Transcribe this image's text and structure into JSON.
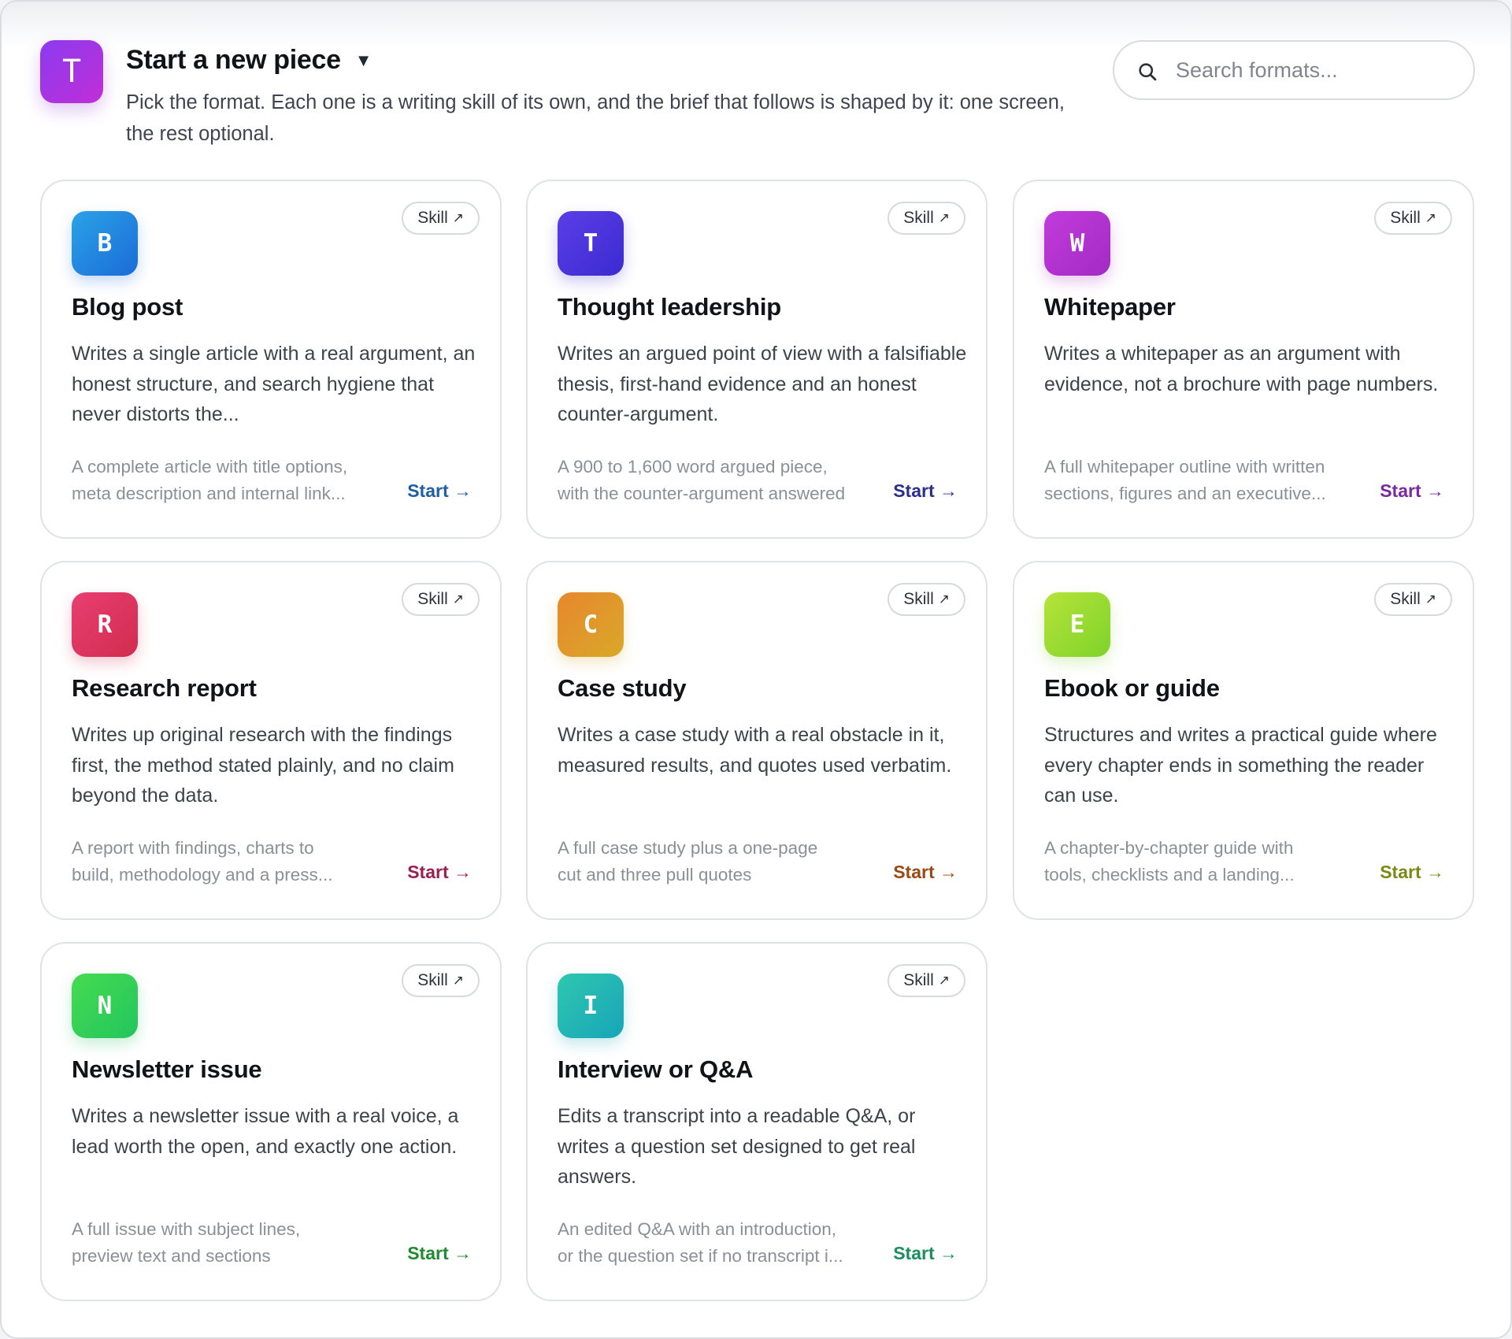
{
  "header": {
    "logo_letter": "T",
    "title": "Start a new piece",
    "caret": "▼",
    "subtitle": "Pick the format. Each one is a writing skill of its own, and the brief that follows is shaped by it: one screen, the rest optional."
  },
  "search": {
    "placeholder": "Search formats..."
  },
  "cards": [
    {
      "letter": "B",
      "title": "Blog post",
      "badge": "Skill",
      "badge_icon": "↗",
      "description": "Writes a single article with a real argument, an honest structure, and search hygiene that never distorts the...",
      "output_line1": "A complete article with title options,",
      "output_line2": "meta description and internal link...",
      "start_label": "Start →",
      "start_color": "#1f5fa3",
      "icon_gradient": [
        "#2aa3e6",
        "#1b6bd8"
      ]
    },
    {
      "letter": "T",
      "title": "Thought leadership",
      "badge": "Skill",
      "badge_icon": "↗",
      "description": "Writes an argued point of view with a falsifiable thesis, first-hand evidence and an honest counter-argument.",
      "output_line1": "A 900 to 1,600 word argued piece,",
      "output_line2": "with the counter-argument answered",
      "start_label": "Start →",
      "start_color": "#2b2f8f",
      "icon_gradient": [
        "#5b3ee6",
        "#3b2bd0"
      ]
    },
    {
      "letter": "W",
      "title": "Whitepaper",
      "badge": "Skill",
      "badge_icon": "↗",
      "description": "Writes a whitepaper as an argument with evidence, not a brochure with page numbers.",
      "output_line1": "A full whitepaper outline with written",
      "output_line2": "sections, figures and an executive...",
      "start_label": "Start →",
      "start_color": "#7a2a9c",
      "icon_gradient": [
        "#c23bdc",
        "#a22bc4"
      ]
    },
    {
      "letter": "R",
      "title": "Research report",
      "badge": "Skill",
      "badge_icon": "↗",
      "description": "Writes up original research with the findings first, the method stated plainly, and no claim beyond the data.",
      "output_line1": "A report with findings, charts to",
      "output_line2": "build, methodology and a press...",
      "start_label": "Start →",
      "start_color": "#9c1f52",
      "icon_gradient": [
        "#e93e72",
        "#d12d4e"
      ]
    },
    {
      "letter": "C",
      "title": "Case study",
      "badge": "Skill",
      "badge_icon": "↗",
      "description": "Writes a case study with a real obstacle in it, measured results, and quotes used verbatim.",
      "output_line1": "A full case study plus a one-page",
      "output_line2": "cut and three pull quotes",
      "start_label": "Start →",
      "start_color": "#9a4a12",
      "icon_gradient": [
        "#e7872e",
        "#d9a828"
      ]
    },
    {
      "letter": "E",
      "title": "Ebook or guide",
      "badge": "Skill",
      "badge_icon": "↗",
      "description": "Structures and writes a practical guide where every chapter ends in something the reader can use.",
      "output_line1": "A chapter-by-chapter guide with",
      "output_line2": "tools, checklists and a landing...",
      "start_label": "Start →",
      "start_color": "#7a8a14",
      "icon_gradient": [
        "#b6e33a",
        "#7ed32a"
      ]
    },
    {
      "letter": "N",
      "title": "Newsletter issue",
      "badge": "Skill",
      "badge_icon": "↗",
      "description": "Writes a newsletter issue with a real voice, a lead worth the open, and exactly one action.",
      "output_line1": "A full issue with subject lines,",
      "output_line2": "preview text and sections",
      "start_label": "Start →",
      "start_color": "#1f8a2f",
      "icon_gradient": [
        "#46db50",
        "#22c55e"
      ]
    },
    {
      "letter": "I",
      "title": "Interview or Q&A",
      "badge": "Skill",
      "badge_icon": "↗",
      "description": "Edits a transcript into a readable Q&A, or writes a question set designed to get real answers.",
      "output_line1": "An edited Q&A with an introduction,",
      "output_line2": "or the question set if no transcript i...",
      "start_label": "Start →",
      "start_color": "#1a8f5c",
      "icon_gradient": [
        "#2fc7b0",
        "#17a5b8"
      ]
    }
  ]
}
